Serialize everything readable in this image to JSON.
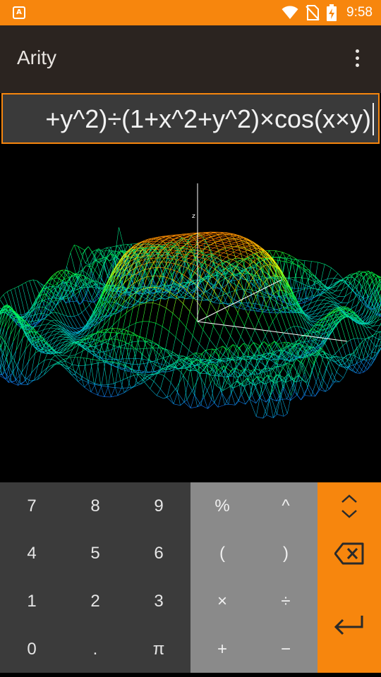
{
  "status_bar": {
    "notification_icon_name": "text-a-notification-icon",
    "notification_glyph": "A",
    "wifi_icon_name": "wifi-icon",
    "no_sim_icon_name": "no-sim-icon",
    "battery_icon_name": "battery-charging-icon",
    "time": "9:58",
    "background": "#f7860d"
  },
  "app_bar": {
    "title": "Arity",
    "overflow_icon_name": "more-vert-icon",
    "background": "#2b2420"
  },
  "formula": {
    "visible_text": "+y^2)÷(1+x^2+y^2)×cos(x×y)",
    "accent": "#f7860d"
  },
  "graph": {
    "type": "3d-surface-wireframe",
    "axis_label_z": "z",
    "color_scale": [
      "#1e40ff",
      "#00c8c8",
      "#00ff40",
      "#ffff00",
      "#ff3000"
    ]
  },
  "keypad": {
    "numbers": [
      [
        "7",
        "8",
        "9"
      ],
      [
        "4",
        "5",
        "6"
      ],
      [
        "1",
        "2",
        "3"
      ],
      [
        "0",
        ".",
        "π"
      ]
    ],
    "operators": [
      [
        "%",
        "^"
      ],
      [
        "(",
        ")"
      ],
      [
        "×",
        "÷"
      ],
      [
        "+",
        "−"
      ]
    ],
    "functions": {
      "toggle_icon_name": "expand-collapse-icon",
      "backspace_icon_name": "backspace-icon",
      "enter_icon_name": "enter-return-icon"
    },
    "colors": {
      "numbers_bg": "#3b3b3b",
      "operators_bg": "#8a8a8a",
      "functions_bg": "#f7860d"
    }
  }
}
